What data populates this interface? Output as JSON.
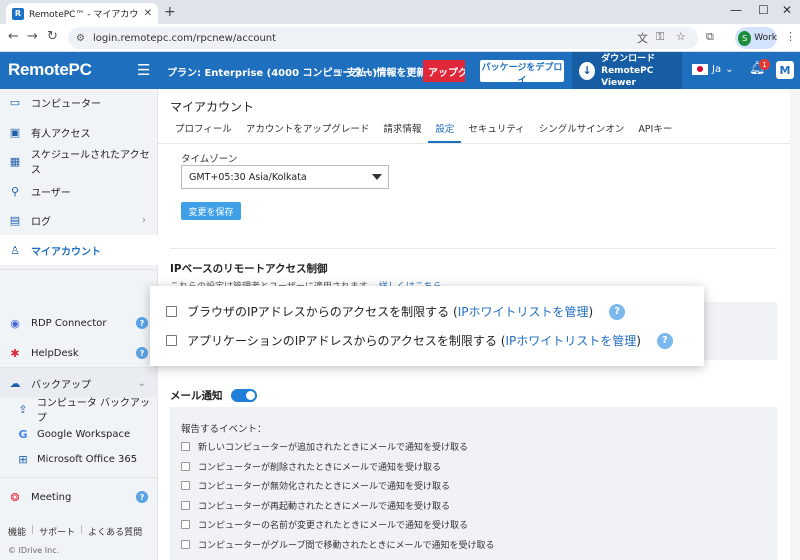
{
  "browser": {
    "tab_title": "RemotePC™ - マイアカウント情報",
    "url": "login.remotepc.com/rpcnew/account",
    "profile_label": "Work",
    "profile_initial": "S"
  },
  "header": {
    "logo": "RemotePC",
    "plan": "プラン: Enterprise (4000 コンピューター)",
    "payment": "支払い情報を更新",
    "upgrade": "アップグレ",
    "deploy": "パッケージをデプロイ",
    "download_line1": "ダウンロード",
    "download_line2": "RemotePC Viewer",
    "lang": "Ja",
    "notifications": "1",
    "avatar": "M"
  },
  "sidebar": {
    "items": [
      {
        "label": "コンピューター",
        "icon": "monitor-icon"
      },
      {
        "label": "有人アクセス",
        "icon": "screen-share-icon"
      },
      {
        "label": "スケジュールされたアクセス",
        "icon": "calendar-icon"
      },
      {
        "label": "ユーザー",
        "icon": "user-key-icon"
      },
      {
        "label": "ログ",
        "icon": "folder-icon"
      },
      {
        "label": "マイアカウント",
        "icon": "person-icon"
      },
      {
        "label": "RDP Connector",
        "icon": "rdp-icon"
      },
      {
        "label": "HelpDesk",
        "icon": "lifebuoy-icon"
      },
      {
        "label": "バックアップ",
        "icon": "cloud-icon"
      },
      {
        "label": "コンピュータ バックアップ",
        "icon": "upload-icon"
      },
      {
        "label": "Google Workspace",
        "icon": "google-icon"
      },
      {
        "label": "Microsoft Office 365",
        "icon": "windows-icon"
      },
      {
        "label": "Meeting",
        "icon": "meeting-icon"
      }
    ],
    "footer": [
      "機能",
      "サポート",
      "よくある質問"
    ],
    "copyright": "© IDrive Inc."
  },
  "main": {
    "title": "マイアカウント",
    "tabs": [
      "プロフィール",
      "アカウントをアップグレード",
      "請求情報",
      "設定",
      "セキュリティ",
      "シングルサインオン",
      "APIキー"
    ],
    "active_tab": "設定",
    "timezone_label": "タイムゾーン",
    "timezone_value": "GMT+05:30 Asia/Kolkata",
    "save_label": "変更を保存",
    "ip_title": "IPベースのリモートアクセス制御",
    "ip_desc": "これらの設定は管理者とユーザーに適用されます。",
    "ip_desc_link": "詳しくはこちら",
    "ip_options": [
      {
        "text": "ブラウザのIPアドレスからのアクセスを制限する (",
        "link": "IPホワイトリストを管理",
        "tail": ")"
      },
      {
        "text": "アプリケーションのIPアドレスからのアクセスを制限する (",
        "link": "IPホワイトリストを管理",
        "tail": ")"
      }
    ],
    "mail_title": "メール通知",
    "events_title": "報告するイベント：",
    "events": [
      "新しいコンピューターが追加されたときにメールで通知を受け取る",
      "コンピューターが削除されたときにメールで通知を受け取る",
      "コンピューターが無効化されたときにメールで通知を受け取る",
      "コンピューターが再起動されたときにメールで通知を受け取る",
      "コンピューターの名前が変更されたときにメールで通知を受け取る",
      "コンピューターがグループ間で移動されたときにメールで通知を受け取る"
    ]
  }
}
